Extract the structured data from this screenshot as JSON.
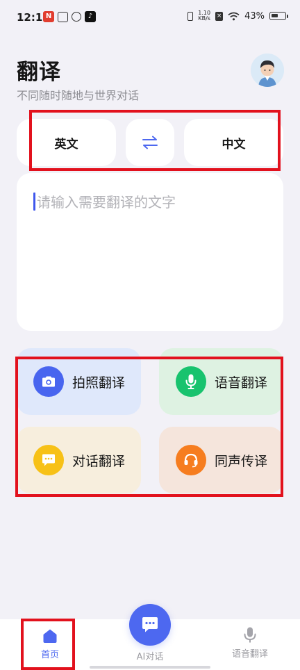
{
  "status_bar": {
    "time": "12:11",
    "net_speed_value": "1.10",
    "net_speed_unit": "KB/s",
    "battery": "43%"
  },
  "header": {
    "title": "翻译",
    "subtitle": "不同随时随地与世界对话"
  },
  "languages": {
    "source": "英文",
    "target": "中文",
    "swap_icon": "swap-arrows-icon"
  },
  "input": {
    "placeholder": "请输入需要翻译的文字",
    "value": ""
  },
  "features": [
    {
      "label": "拍照翻译",
      "icon": "camera-icon",
      "color": "#4865ef",
      "bg": "#dfe8fb"
    },
    {
      "label": "语音翻译",
      "icon": "microphone-icon",
      "color": "#18c36e",
      "bg": "#def2e2"
    },
    {
      "label": "对话翻译",
      "icon": "chat-bubble-icon",
      "color": "#f7c117",
      "bg": "#f7eedd"
    },
    {
      "label": "同声传译",
      "icon": "headset-icon",
      "color": "#f67d1f",
      "bg": "#f5e5dc"
    }
  ],
  "bottom_nav": {
    "home": "首页",
    "ai_chat": "AI对话",
    "voice": "语音翻译",
    "active_color": "#4d68f0",
    "inactive_color": "#9a9aa0"
  }
}
